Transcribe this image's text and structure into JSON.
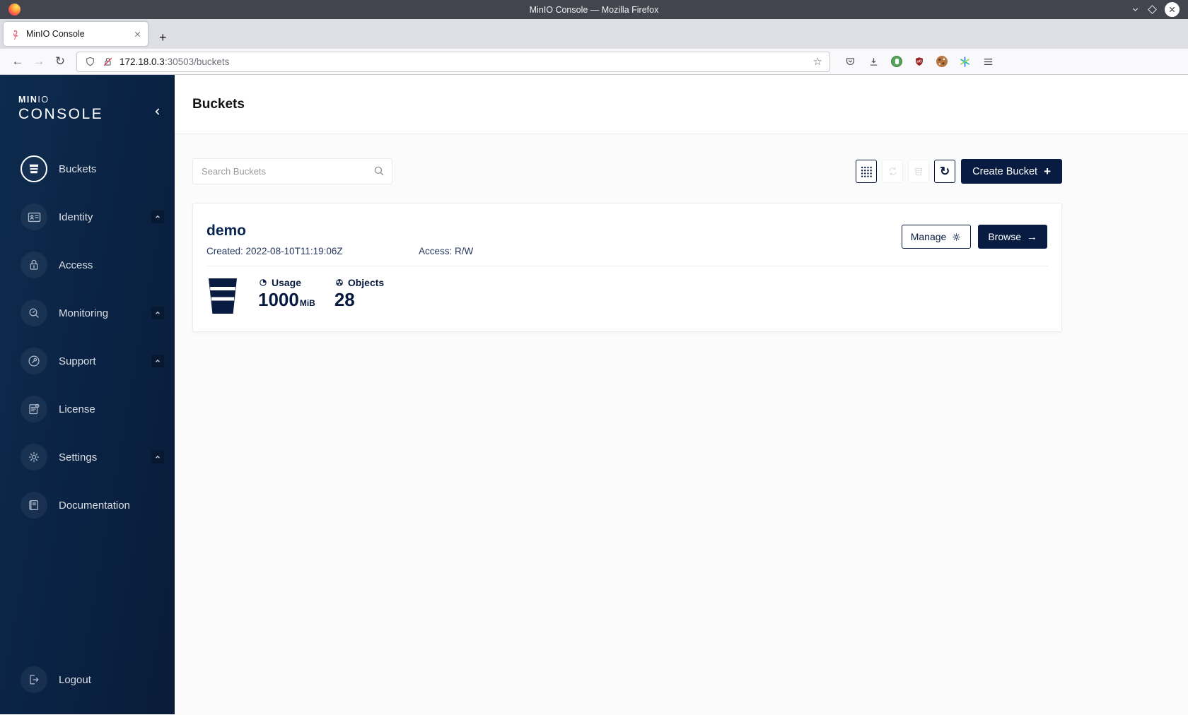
{
  "window": {
    "title": "MinIO Console — Mozilla Firefox"
  },
  "browser": {
    "tab_title": "MinIO Console",
    "url_host": "172.18.0.3",
    "url_path": ":30503/buckets"
  },
  "glyphs": {
    "back": "←",
    "forward": "→",
    "refresh": "↻",
    "star": "☆",
    "plus": "+",
    "new_tab": "+",
    "arrow_right": "→",
    "ublock": "uO"
  },
  "sidebar": {
    "logo_bold": "MIN",
    "logo_light": "IO",
    "logo_word": "CONSOLE",
    "items": [
      {
        "label": "Buckets"
      },
      {
        "label": "Identity"
      },
      {
        "label": "Access"
      },
      {
        "label": "Monitoring"
      },
      {
        "label": "Support"
      },
      {
        "label": "License"
      },
      {
        "label": "Settings"
      },
      {
        "label": "Documentation"
      }
    ],
    "logout_label": "Logout"
  },
  "page": {
    "title": "Buckets",
    "search_placeholder": "Search Buckets",
    "create_button_label": "Create Bucket",
    "bucket": {
      "name": "demo",
      "created": "Created: 2022-08-10T11:19:06Z",
      "access": "Access: R/W",
      "usage_label": "Usage",
      "usage_value": "1000",
      "usage_unit": "MiB",
      "objects_label": "Objects",
      "objects_value": "28",
      "manage_label": "Manage",
      "browse_label": "Browse"
    }
  },
  "colors": {
    "primary": "#081C42",
    "sidebar_from": "#0D2B4E",
    "sidebar_to": "#091C38",
    "strike_red": "#D7354A"
  }
}
